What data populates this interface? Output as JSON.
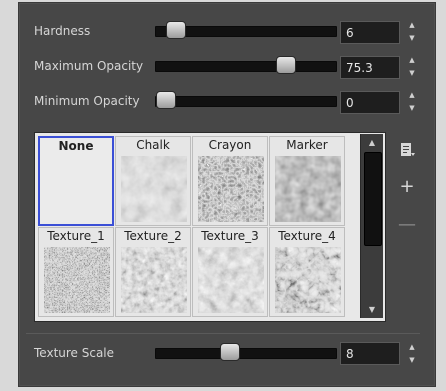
{
  "settings": {
    "hardness": {
      "label": "Hardness",
      "value": "6",
      "fraction": 0.06
    },
    "max_opacity": {
      "label": "Maximum Opacity",
      "value": "75.3",
      "fraction": 0.753
    },
    "min_opacity": {
      "label": "Minimum Opacity",
      "value": "0",
      "fraction": 0.0
    },
    "texture_scale": {
      "label": "Texture Scale",
      "value": "8",
      "fraction": 0.4
    }
  },
  "textures": [
    {
      "name": "None",
      "selected": true
    },
    {
      "name": "Chalk",
      "selected": false
    },
    {
      "name": "Crayon",
      "selected": false
    },
    {
      "name": "Marker",
      "selected": false
    },
    {
      "name": "Texture_1",
      "selected": false
    },
    {
      "name": "Texture_2",
      "selected": false
    },
    {
      "name": "Texture_3",
      "selected": false
    },
    {
      "name": "Texture_4",
      "selected": false
    }
  ],
  "side_buttons": {
    "import": "document-icon",
    "add": "+",
    "remove": "—"
  },
  "colors": {
    "panel_bg": "#474747",
    "selection_border": "#3b4fd6",
    "field_bg": "#1e1e1e"
  }
}
